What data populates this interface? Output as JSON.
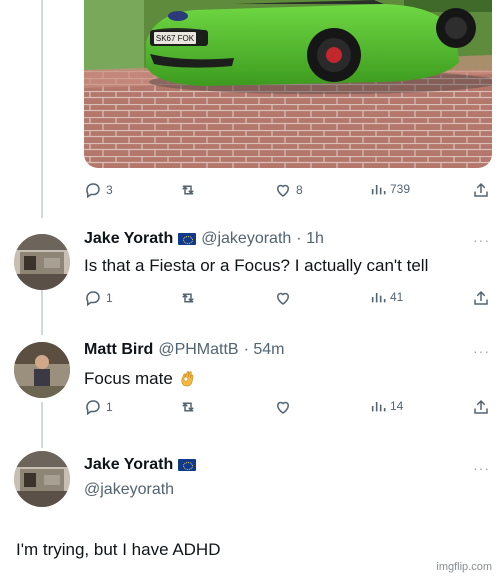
{
  "colors": {
    "text": "#0f1419",
    "muted": "#536471",
    "line": "#cfd9de"
  },
  "media": {
    "car_color": "#4fc02b",
    "plate_text": "SK67 FOK"
  },
  "post_actions": {
    "replies": "3",
    "retweets": "",
    "likes": "8",
    "views": "739"
  },
  "tweets": [
    {
      "name": "Jake Yorath",
      "handle": "@jakeyorath",
      "time": "· 1h",
      "text": "Is that a Fiesta or a Focus? I actually can't tell",
      "actions": {
        "replies": "1",
        "likes": "",
        "views": "41"
      }
    },
    {
      "name": "Matt Bird",
      "handle": "@PHMattB",
      "time": "· 54m",
      "text": "Focus mate",
      "emoji": "ok-hand-emoji",
      "actions": {
        "replies": "1",
        "likes": "",
        "views": "14"
      }
    }
  ],
  "reply": {
    "name": "Jake Yorath",
    "handle": "@jakeyorath",
    "text": "I'm trying, but I have ADHD"
  },
  "more_label": "···",
  "watermark": "imgflip.com"
}
